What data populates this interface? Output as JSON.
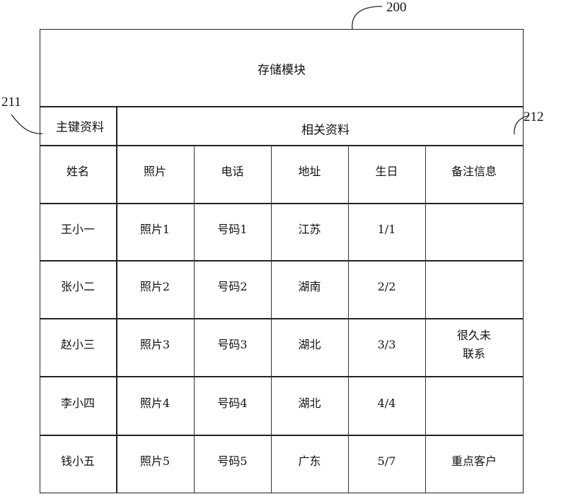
{
  "diagram": {
    "reference_labels": {
      "module": "200",
      "primary_key": "211",
      "related": "212"
    },
    "module_title": "存储模块",
    "section_headers": {
      "primary_key": "主键资料",
      "related": "相关资料"
    },
    "table": {
      "columns": [
        "姓名",
        "照片",
        "电话",
        "地址",
        "生日",
        "备注信息"
      ],
      "rows": [
        [
          "王小一",
          "照片1",
          "号码1",
          "江苏",
          "1/1",
          ""
        ],
        [
          "张小二",
          "照片2",
          "号码2",
          "湖南",
          "2/2",
          ""
        ],
        [
          "赵小三",
          "照片3",
          "号码3",
          "湖北",
          "3/3",
          "很久未\n联系"
        ],
        [
          "李小四",
          "照片4",
          "号码4",
          "湖北",
          "4/4",
          ""
        ],
        [
          "钱小五",
          "照片5",
          "号码5",
          "广东",
          "5/7",
          "重点客户"
        ]
      ]
    }
  }
}
